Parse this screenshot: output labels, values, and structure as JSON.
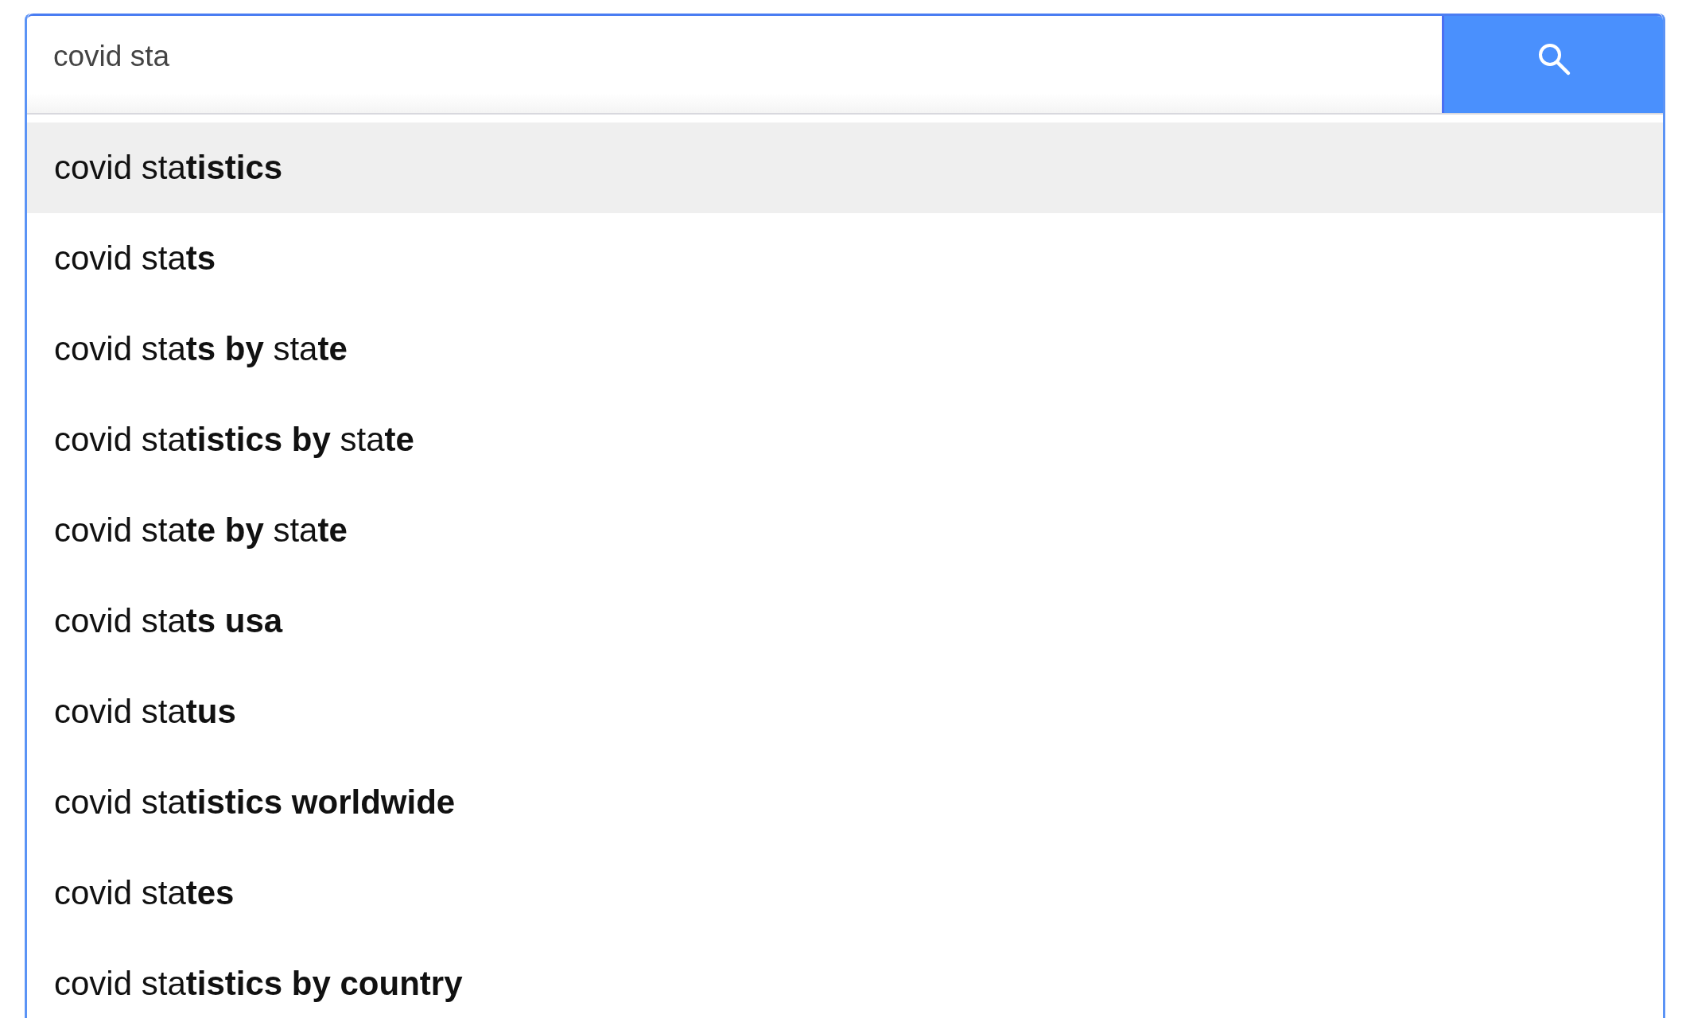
{
  "search": {
    "value": "covid sta"
  },
  "suggestions": [
    {
      "text": "covid sta**tistics**",
      "selected": true
    },
    {
      "text": "covid sta**ts**",
      "selected": false
    },
    {
      "text": "covid sta**ts by** sta**te**",
      "selected": false
    },
    {
      "text": "covid sta**tistics by** sta**te**",
      "selected": false
    },
    {
      "text": "covid sta**te by** sta**te**",
      "selected": false
    },
    {
      "text": "covid sta**ts usa**",
      "selected": false
    },
    {
      "text": "covid sta**tus**",
      "selected": false
    },
    {
      "text": "covid sta**tistics worldwide**",
      "selected": false
    },
    {
      "text": "covid sta**tes**",
      "selected": false
    },
    {
      "text": "covid sta**tistics by country**",
      "selected": false
    }
  ]
}
